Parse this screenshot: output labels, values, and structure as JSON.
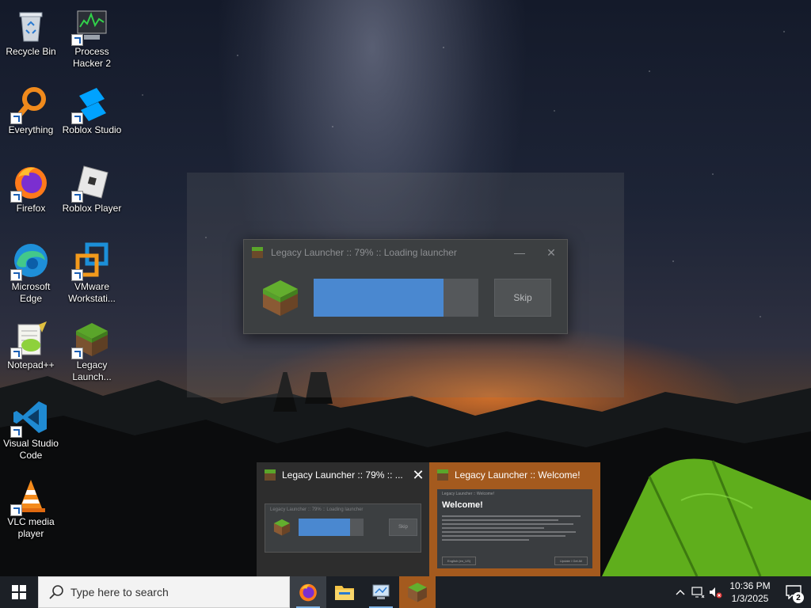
{
  "desktop": {
    "icons": [
      {
        "label": "Recycle Bin",
        "icon": "recycle-bin-icon"
      },
      {
        "label": "Process Hacker 2",
        "icon": "process-hacker-icon"
      },
      {
        "label": "Everything",
        "icon": "everything-search-icon"
      },
      {
        "label": "Roblox Studio",
        "icon": "roblox-studio-icon"
      },
      {
        "label": "Firefox",
        "icon": "firefox-icon"
      },
      {
        "label": "Roblox Player",
        "icon": "roblox-player-icon"
      },
      {
        "label": "Microsoft Edge",
        "icon": "edge-icon"
      },
      {
        "label": "VMware Workstati...",
        "icon": "vmware-icon"
      },
      {
        "label": "Notepad++",
        "icon": "notepadpp-icon"
      },
      {
        "label": "Legacy Launch...",
        "icon": "minecraft-grass-icon"
      },
      {
        "label": "Visual Studio Code",
        "icon": "vscode-icon"
      },
      {
        "label": "VLC media player",
        "icon": "vlc-icon"
      }
    ]
  },
  "launcher": {
    "title": "Legacy Launcher :: 79% :: Loading launcher",
    "progress": 0.79,
    "skip_label": "Skip",
    "minimize_symbol": "—",
    "close_symbol": "✕"
  },
  "previews": [
    {
      "title": "Legacy Launcher :: 79% :: ...",
      "close_symbol": "✕",
      "thumb_title": "Legacy Launcher :: 79% :: Loading launcher",
      "thumb_skip": "Skip"
    },
    {
      "title": "Legacy Launcher :: Welcome!",
      "thumb_top": "Legacy Launcher :: Welcome!",
      "thumb_heading": "Welcome!",
      "thumb_left_btn": "English (en_US)",
      "thumb_right_btn": "Update / Get All"
    }
  ],
  "taskbar": {
    "search_placeholder": "Type here to search",
    "clock_time": "10:36 PM",
    "clock_date": "1/3/2025",
    "notification_count": "2",
    "colors": {
      "taskbar": "#1c2026",
      "active_orange": "#a45a1e",
      "accent_blue": "#4a88d0"
    }
  }
}
